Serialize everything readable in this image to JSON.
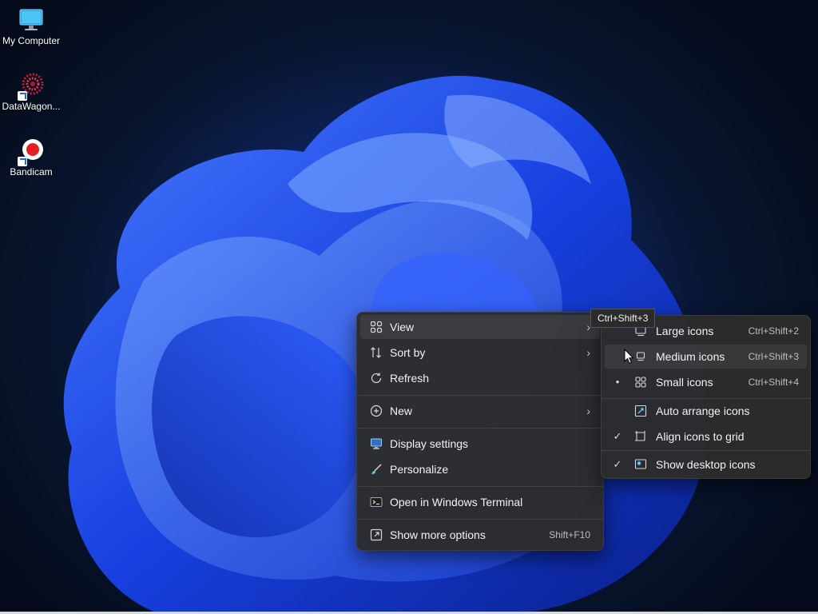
{
  "desktop": {
    "icons": [
      {
        "label": "My Computer",
        "icon": "monitor-icon"
      },
      {
        "label": "DataWagon...",
        "icon": "datawagon-icon"
      },
      {
        "label": "Bandicam",
        "icon": "bandicam-icon"
      }
    ]
  },
  "context_menu": {
    "items": [
      {
        "label": "View",
        "icon": "view-grid-icon",
        "has_submenu": true
      },
      {
        "label": "Sort by",
        "icon": "sort-icon",
        "has_submenu": true
      },
      {
        "label": "Refresh",
        "icon": "refresh-icon"
      },
      {
        "label": "New",
        "icon": "new-plus-icon",
        "has_submenu": true
      },
      {
        "label": "Display settings",
        "icon": "display-icon"
      },
      {
        "label": "Personalize",
        "icon": "brush-icon"
      },
      {
        "label": "Open in Windows Terminal",
        "icon": "terminal-icon"
      },
      {
        "label": "Show more options",
        "icon": "more-options-icon",
        "shortcut": "Shift+F10"
      }
    ]
  },
  "view_submenu": {
    "items": [
      {
        "label": "Large icons",
        "shortcut": "Ctrl+Shift+2",
        "icon": "large-icons-icon"
      },
      {
        "label": "Medium icons",
        "shortcut": "Ctrl+Shift+3",
        "icon": "medium-icons-icon"
      },
      {
        "label": "Small icons",
        "shortcut": "Ctrl+Shift+4",
        "icon": "small-icons-icon",
        "selected": "•"
      },
      {
        "label": "Auto arrange icons",
        "icon": "auto-arrange-icon"
      },
      {
        "label": "Align icons to grid",
        "icon": "align-grid-icon",
        "checked": "✓"
      },
      {
        "label": "Show desktop icons",
        "icon": "show-desktop-icon",
        "checked": "✓"
      }
    ]
  },
  "tooltip": {
    "text": "Ctrl+Shift+3"
  },
  "colors": {
    "menu_bg": "#2c2c2c",
    "accent": "#60cdff",
    "wallpaper": "#1d3fae"
  }
}
